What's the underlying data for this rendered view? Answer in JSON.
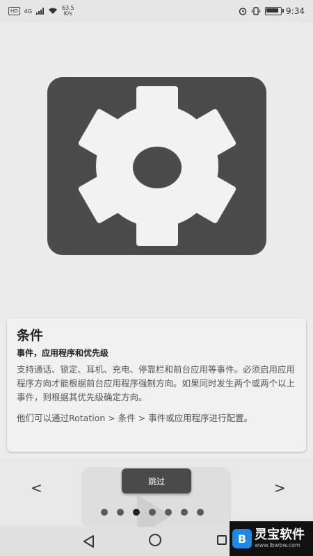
{
  "status_bar": {
    "hd": "HD",
    "network": "4G",
    "speed_value": "63.5",
    "speed_unit": "K/s",
    "time": "9:34"
  },
  "hero": {
    "icon": "gear-icon"
  },
  "card": {
    "title": "条件",
    "subtitle": "事件，应用程序和优先级",
    "body": "支持通话、锁定、耳机、充电、停靠栏和前台应用等事件。必须启用应用程序方向才能根据前台应用程序强制方向。如果同时发生两个或两个以上事件，则根据其优先级确定方向。",
    "note": "他们可以通过Rotation > 条件 > 事件或应用程序进行配置。"
  },
  "navigation": {
    "skip_label": "跳过",
    "prev_label": "<",
    "next_label": ">",
    "dot_count": 7,
    "active_dot": 2
  },
  "watermark": {
    "logo": "B",
    "name": "灵宝软件",
    "url": "www.lbwbw.com"
  },
  "colors": {
    "background": "#ececec",
    "hero": "#4b4b4b",
    "button": "#4a4a4a"
  }
}
